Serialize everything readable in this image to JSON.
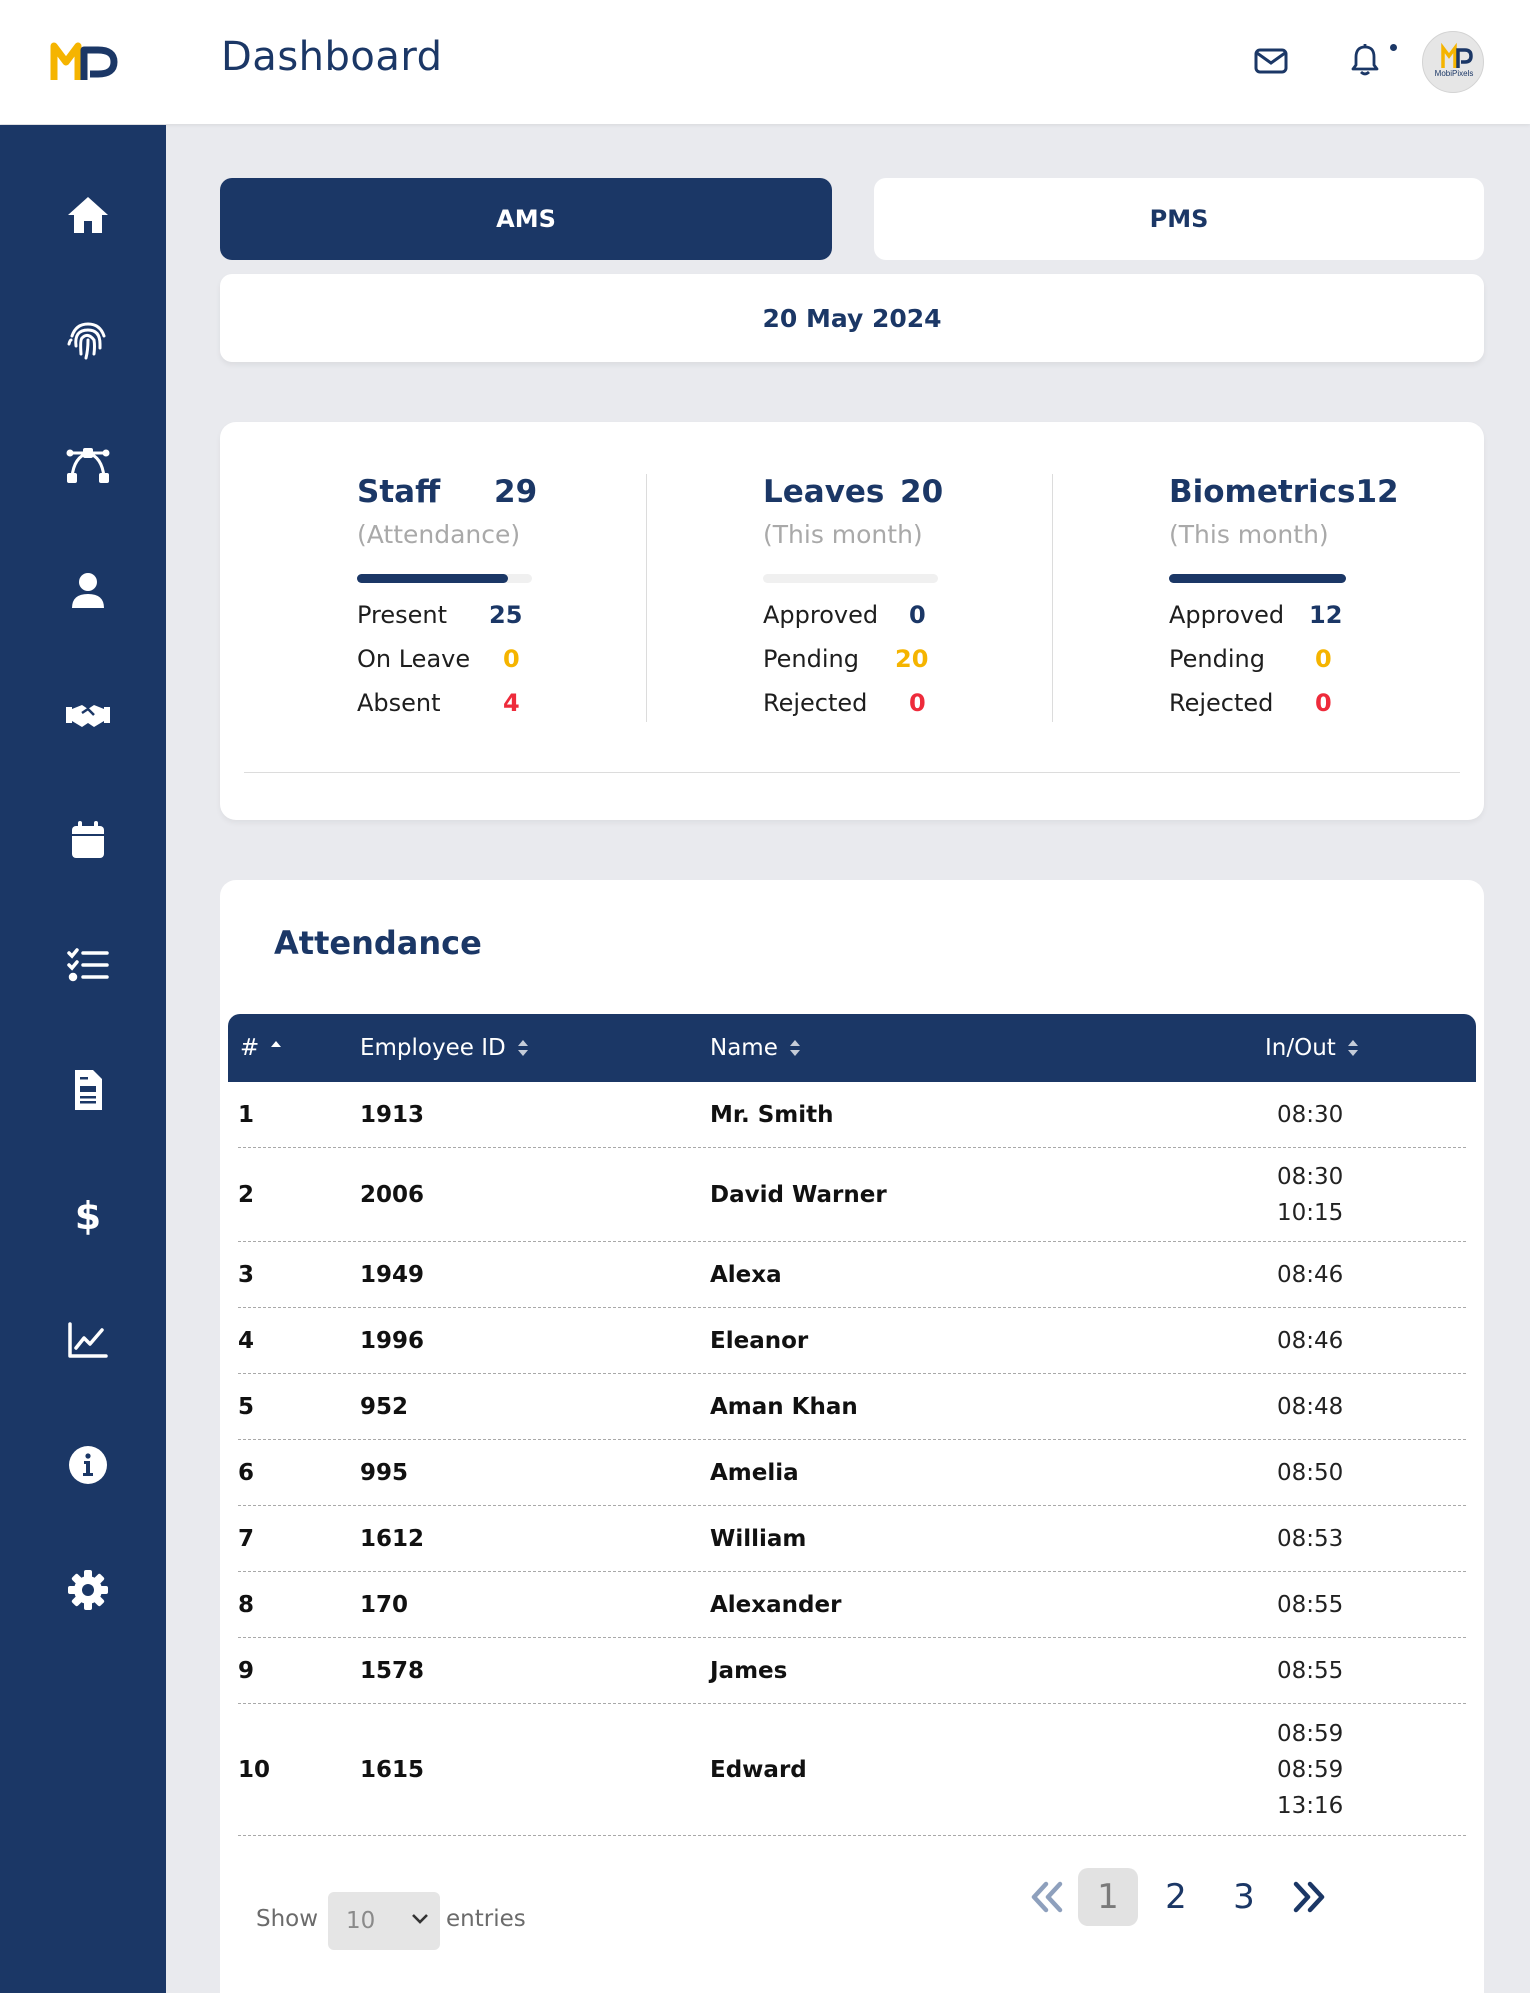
{
  "header": {
    "title": "Dashboard",
    "logo_icon": "mobipixels-logo",
    "avatar_label": "MobiPixels",
    "icons": [
      "mail-icon",
      "bell-icon"
    ]
  },
  "sidebar": {
    "items": [
      {
        "icon": "home-icon"
      },
      {
        "icon": "fingerprint-icon"
      },
      {
        "icon": "bezier-curve-icon"
      },
      {
        "icon": "user-icon"
      },
      {
        "icon": "handshake-icon"
      },
      {
        "icon": "calendar-icon"
      },
      {
        "icon": "task-list-icon"
      },
      {
        "icon": "document-icon"
      },
      {
        "icon": "dollar-icon"
      },
      {
        "icon": "chart-line-icon"
      },
      {
        "icon": "info-icon"
      },
      {
        "icon": "gear-icon"
      }
    ]
  },
  "tabs": {
    "ams": "AMS",
    "pms": "PMS"
  },
  "date": "20 May 2024",
  "stats": {
    "staff": {
      "title": "Staff",
      "count": "29",
      "subtitle": "(Attendance)",
      "progress": 0.86,
      "rows": [
        {
          "label": "Present",
          "value": "25",
          "color": "#1b3766"
        },
        {
          "label": "On Leave",
          "value": "0",
          "color": "#f5b400"
        },
        {
          "label": "Absent",
          "value": "4",
          "color": "#ee2b3b"
        }
      ]
    },
    "leaves": {
      "title": "Leaves",
      "count": "20",
      "subtitle": "(This month)",
      "progress": 0,
      "rows": [
        {
          "label": "Approved",
          "value": "0",
          "color": "#1b3766"
        },
        {
          "label": "Pending",
          "value": "20",
          "color": "#f5b400"
        },
        {
          "label": "Rejected",
          "value": "0",
          "color": "#ee2b3b"
        }
      ]
    },
    "biometrics": {
      "title": "Biometrics12",
      "subtitle": "(This month)",
      "progress": 1,
      "rows": [
        {
          "label": "Approved",
          "value": "12",
          "color": "#1b3766"
        },
        {
          "label": "Pending",
          "value": "0",
          "color": "#f5b400"
        },
        {
          "label": "Rejected",
          "value": "0",
          "color": "#ee2b3b"
        }
      ]
    }
  },
  "attendance": {
    "title": "Attendance",
    "columns": [
      "#",
      "Employee ID",
      "Name",
      "In/Out"
    ],
    "rows": [
      {
        "n": "1",
        "id": "1913",
        "name": "Mr. Smith",
        "times": [
          "08:30"
        ]
      },
      {
        "n": "2",
        "id": "2006",
        "name": "David Warner",
        "times": [
          "08:30",
          "10:15"
        ]
      },
      {
        "n": "3",
        "id": "1949",
        "name": "Alexa",
        "times": [
          "08:46"
        ]
      },
      {
        "n": "4",
        "id": "1996",
        "name": "Eleanor",
        "times": [
          "08:46"
        ]
      },
      {
        "n": "5",
        "id": "952",
        "name": "Aman Khan",
        "times": [
          "08:48"
        ]
      },
      {
        "n": "6",
        "id": "995",
        "name": "Amelia",
        "times": [
          "08:50"
        ]
      },
      {
        "n": "7",
        "id": "1612",
        "name": "William",
        "times": [
          "08:53"
        ]
      },
      {
        "n": "8",
        "id": "170",
        "name": "Alexander",
        "times": [
          "08:55"
        ]
      },
      {
        "n": "9",
        "id": "1578",
        "name": "James",
        "times": [
          "08:55"
        ]
      },
      {
        "n": "10",
        "id": "1615",
        "name": "Edward",
        "times": [
          "08:59",
          "08:59",
          "13:16"
        ]
      }
    ],
    "show_label": "Show",
    "entries_value": "10",
    "entries_label": "entries",
    "pages": [
      "1",
      "2",
      "3"
    ],
    "active_page": "1"
  },
  "colors": {
    "primary": "#1b3766",
    "accent": "#f5b400",
    "danger": "#ee2b3b",
    "background": "#e9eaee"
  }
}
